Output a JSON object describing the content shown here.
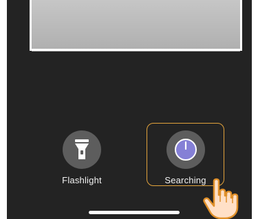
{
  "controls": {
    "flashlight": {
      "label": "Flashlight",
      "icon": "flashlight-icon"
    },
    "searching": {
      "label": "Searching",
      "icon": "power-icon",
      "highlight_color": "#e3a33c"
    }
  },
  "colors": {
    "background": "#232323",
    "button_circle": "#5d5d5d",
    "power_circle": "#8580d6"
  }
}
